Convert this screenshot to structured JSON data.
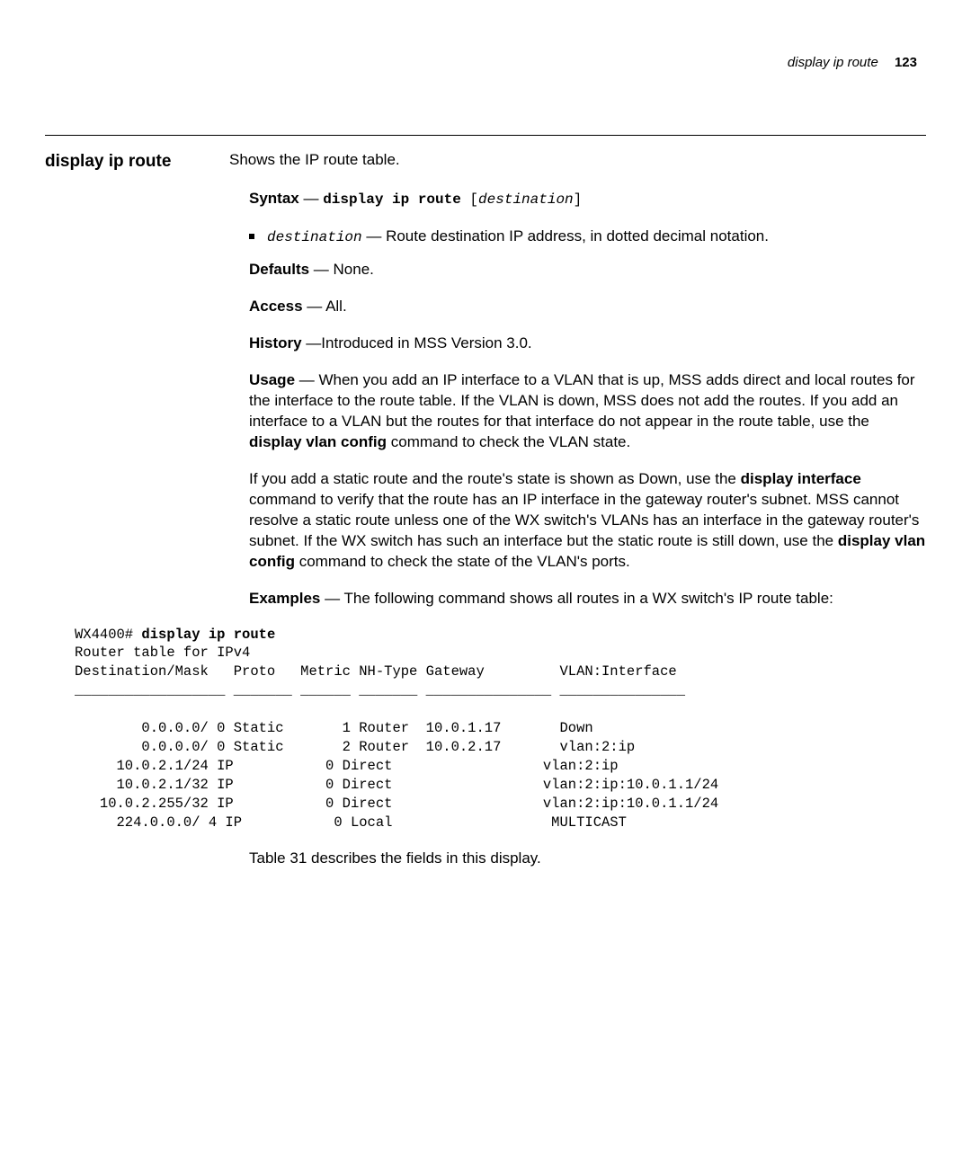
{
  "header": {
    "running": "display ip route",
    "page": "123"
  },
  "title": "display ip route",
  "intro": "Shows the IP route table.",
  "syntax": {
    "label": "Syntax",
    "dash": " — ",
    "cmd": "display ip route",
    "arg_open": " [",
    "arg": "destination",
    "arg_close": "]"
  },
  "param": {
    "name": "destination",
    "dash": " — ",
    "desc": "Route destination IP address, in dotted decimal notation."
  },
  "defaults": {
    "label": "Defaults",
    "value": " — None."
  },
  "access": {
    "label": "Access",
    "value": " — All."
  },
  "history": {
    "label": "History",
    "value": " —Introduced in MSS Version 3.0."
  },
  "usage": {
    "label": "Usage",
    "p1a": " — When you add an IP interface to a VLAN that is up, MSS adds direct and local routes for the interface to the route table. If the VLAN is down, MSS does not add the routes. If you add an interface to a VLAN but the routes for that interface do not appear in the route table, use the ",
    "p1b_bold": "display vlan config",
    "p1c": " command to check the VLAN state.",
    "p2a": "If you add a static route and the route's state is shown as Down, use the ",
    "p2b_bold": "display interface",
    "p2c": " command to verify that the route has an IP interface in the gateway router's subnet. MSS cannot resolve a static route unless one of the WX switch's VLANs has an interface in the gateway router's subnet. If the WX switch has such an interface but the static route is still down, use the ",
    "p2d_bold": "display vlan config",
    "p2e": " command to check the state of the VLAN's ports."
  },
  "examples": {
    "label": "Examples",
    "text": " — The following command shows all routes in a WX switch's IP route table:"
  },
  "cli_prompt": "WX4400# ",
  "cli_cmd": "display ip route",
  "cli_body": "Router table for IPv4\nDestination/Mask   Proto   Metric NH-Type Gateway         VLAN:Interface\n__________________ _______ ______ _______ _______________ _______________\n\n        0.0.0.0/ 0 Static       1 Router  10.0.1.17       Down\n        0.0.0.0/ 0 Static       2 Router  10.0.2.17       vlan:2:ip\n     10.0.2.1/24 IP           0 Direct                  vlan:2:ip\n     10.0.2.1/32 IP           0 Direct                  vlan:2:ip:10.0.1.1/24\n   10.0.2.255/32 IP           0 Direct                  vlan:2:ip:10.0.1.1/24\n     224.0.0.0/ 4 IP           0 Local                   MULTICAST",
  "table_caption": "Table 31 describes the fields in this display."
}
